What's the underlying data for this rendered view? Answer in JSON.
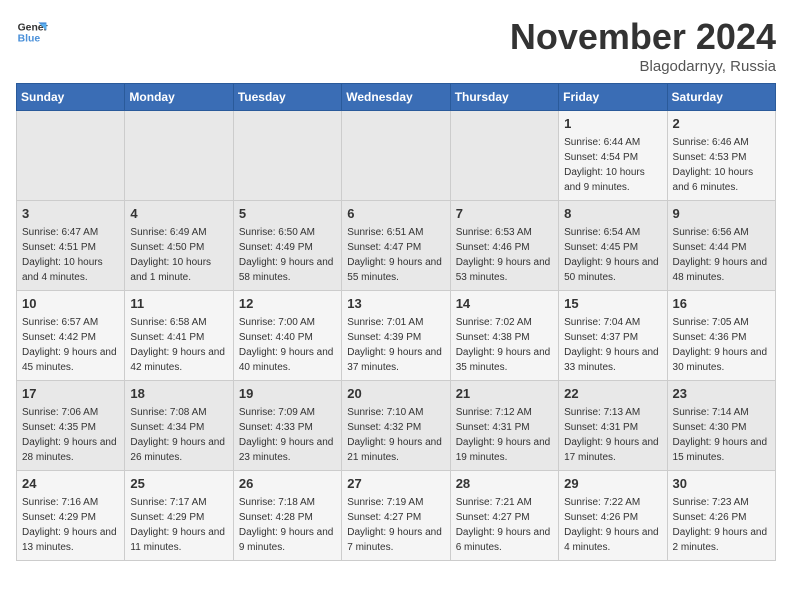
{
  "logo": {
    "line1": "General",
    "line2": "Blue"
  },
  "title": "November 2024",
  "location": "Blagodarnyy, Russia",
  "weekdays": [
    "Sunday",
    "Monday",
    "Tuesday",
    "Wednesday",
    "Thursday",
    "Friday",
    "Saturday"
  ],
  "weeks": [
    [
      {
        "day": "",
        "info": ""
      },
      {
        "day": "",
        "info": ""
      },
      {
        "day": "",
        "info": ""
      },
      {
        "day": "",
        "info": ""
      },
      {
        "day": "",
        "info": ""
      },
      {
        "day": "1",
        "info": "Sunrise: 6:44 AM\nSunset: 4:54 PM\nDaylight: 10 hours and 9 minutes."
      },
      {
        "day": "2",
        "info": "Sunrise: 6:46 AM\nSunset: 4:53 PM\nDaylight: 10 hours and 6 minutes."
      }
    ],
    [
      {
        "day": "3",
        "info": "Sunrise: 6:47 AM\nSunset: 4:51 PM\nDaylight: 10 hours and 4 minutes."
      },
      {
        "day": "4",
        "info": "Sunrise: 6:49 AM\nSunset: 4:50 PM\nDaylight: 10 hours and 1 minute."
      },
      {
        "day": "5",
        "info": "Sunrise: 6:50 AM\nSunset: 4:49 PM\nDaylight: 9 hours and 58 minutes."
      },
      {
        "day": "6",
        "info": "Sunrise: 6:51 AM\nSunset: 4:47 PM\nDaylight: 9 hours and 55 minutes."
      },
      {
        "day": "7",
        "info": "Sunrise: 6:53 AM\nSunset: 4:46 PM\nDaylight: 9 hours and 53 minutes."
      },
      {
        "day": "8",
        "info": "Sunrise: 6:54 AM\nSunset: 4:45 PM\nDaylight: 9 hours and 50 minutes."
      },
      {
        "day": "9",
        "info": "Sunrise: 6:56 AM\nSunset: 4:44 PM\nDaylight: 9 hours and 48 minutes."
      }
    ],
    [
      {
        "day": "10",
        "info": "Sunrise: 6:57 AM\nSunset: 4:42 PM\nDaylight: 9 hours and 45 minutes."
      },
      {
        "day": "11",
        "info": "Sunrise: 6:58 AM\nSunset: 4:41 PM\nDaylight: 9 hours and 42 minutes."
      },
      {
        "day": "12",
        "info": "Sunrise: 7:00 AM\nSunset: 4:40 PM\nDaylight: 9 hours and 40 minutes."
      },
      {
        "day": "13",
        "info": "Sunrise: 7:01 AM\nSunset: 4:39 PM\nDaylight: 9 hours and 37 minutes."
      },
      {
        "day": "14",
        "info": "Sunrise: 7:02 AM\nSunset: 4:38 PM\nDaylight: 9 hours and 35 minutes."
      },
      {
        "day": "15",
        "info": "Sunrise: 7:04 AM\nSunset: 4:37 PM\nDaylight: 9 hours and 33 minutes."
      },
      {
        "day": "16",
        "info": "Sunrise: 7:05 AM\nSunset: 4:36 PM\nDaylight: 9 hours and 30 minutes."
      }
    ],
    [
      {
        "day": "17",
        "info": "Sunrise: 7:06 AM\nSunset: 4:35 PM\nDaylight: 9 hours and 28 minutes."
      },
      {
        "day": "18",
        "info": "Sunrise: 7:08 AM\nSunset: 4:34 PM\nDaylight: 9 hours and 26 minutes."
      },
      {
        "day": "19",
        "info": "Sunrise: 7:09 AM\nSunset: 4:33 PM\nDaylight: 9 hours and 23 minutes."
      },
      {
        "day": "20",
        "info": "Sunrise: 7:10 AM\nSunset: 4:32 PM\nDaylight: 9 hours and 21 minutes."
      },
      {
        "day": "21",
        "info": "Sunrise: 7:12 AM\nSunset: 4:31 PM\nDaylight: 9 hours and 19 minutes."
      },
      {
        "day": "22",
        "info": "Sunrise: 7:13 AM\nSunset: 4:31 PM\nDaylight: 9 hours and 17 minutes."
      },
      {
        "day": "23",
        "info": "Sunrise: 7:14 AM\nSunset: 4:30 PM\nDaylight: 9 hours and 15 minutes."
      }
    ],
    [
      {
        "day": "24",
        "info": "Sunrise: 7:16 AM\nSunset: 4:29 PM\nDaylight: 9 hours and 13 minutes."
      },
      {
        "day": "25",
        "info": "Sunrise: 7:17 AM\nSunset: 4:29 PM\nDaylight: 9 hours and 11 minutes."
      },
      {
        "day": "26",
        "info": "Sunrise: 7:18 AM\nSunset: 4:28 PM\nDaylight: 9 hours and 9 minutes."
      },
      {
        "day": "27",
        "info": "Sunrise: 7:19 AM\nSunset: 4:27 PM\nDaylight: 9 hours and 7 minutes."
      },
      {
        "day": "28",
        "info": "Sunrise: 7:21 AM\nSunset: 4:27 PM\nDaylight: 9 hours and 6 minutes."
      },
      {
        "day": "29",
        "info": "Sunrise: 7:22 AM\nSunset: 4:26 PM\nDaylight: 9 hours and 4 minutes."
      },
      {
        "day": "30",
        "info": "Sunrise: 7:23 AM\nSunset: 4:26 PM\nDaylight: 9 hours and 2 minutes."
      }
    ]
  ]
}
